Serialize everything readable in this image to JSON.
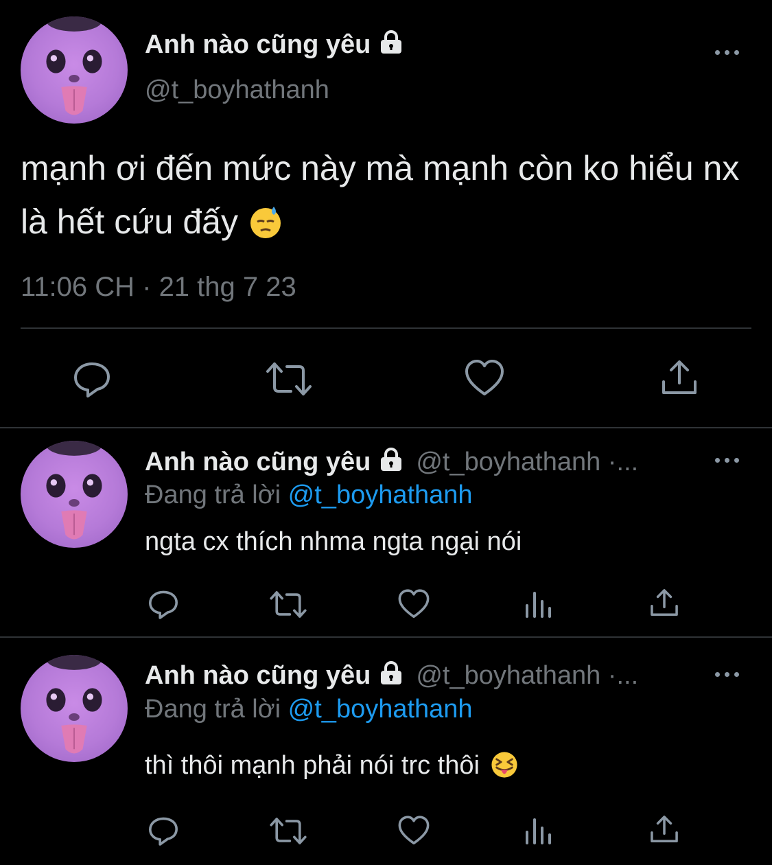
{
  "main_tweet": {
    "display_name": "Anh nào cũng yêu",
    "handle": "@t_boyhathanh",
    "text": "mạnh ơi đến mức này mà mạnh còn ko hiểu nx là hết cứu đấy",
    "timestamp": "11:06 CH · 21 thg 7 23",
    "actions": [
      "reply-icon",
      "retweet-icon",
      "like-icon",
      "share-icon"
    ]
  },
  "replies": [
    {
      "display_name": "Anh nào cũng yêu",
      "handle": "@t_boyhathanh ·...",
      "replying_prefix": "Đang trả lời",
      "replying_to": "@t_boyhathanh",
      "text": "ngta cx thích nhma ngta ngại nói",
      "actions": [
        "reply-icon",
        "retweet-icon",
        "like-icon",
        "views-icon",
        "share-icon"
      ]
    },
    {
      "display_name": "Anh nào cũng yêu",
      "handle": "@t_boyhathanh ·...",
      "replying_prefix": "Đang trả lời",
      "replying_to": "@t_boyhathanh",
      "text": "thì thôi mạnh phải nói trc thôi",
      "actions": [
        "reply-icon",
        "retweet-icon",
        "like-icon",
        "views-icon",
        "share-icon"
      ]
    }
  ],
  "colors": {
    "background": "#000000",
    "text_primary": "#e7e9ea",
    "text_secondary": "#71767b",
    "accent": "#1d9bf0",
    "divider": "#2f3336"
  }
}
